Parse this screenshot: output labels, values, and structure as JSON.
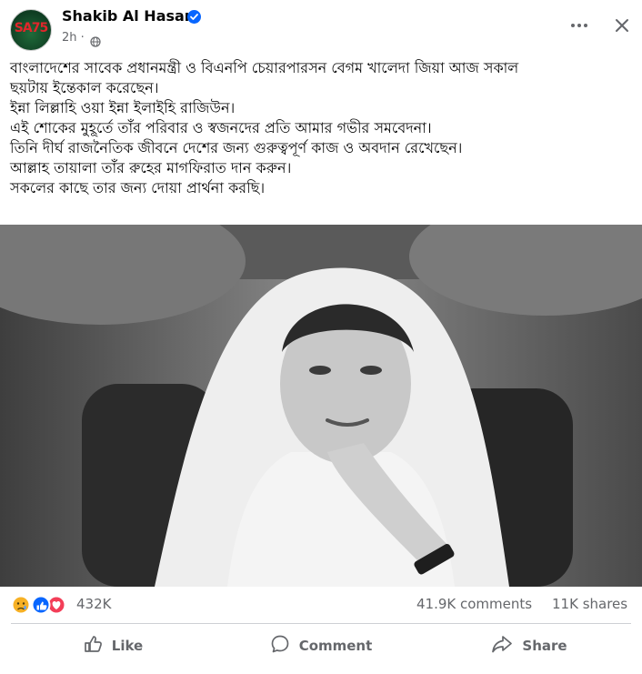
{
  "post": {
    "author": "Shakib Al Hasan",
    "avatar_text": "SA75",
    "time": "2h",
    "separator": "·",
    "message_lines": [
      "বাংলাদেশের সাবেক প্রধানমন্ত্রী ও বিএনপি চেয়ারপারসন বেগম খালেদা জিয়া আজ সকাল",
      "ছয়টায় ইন্তেকাল করেছেন।",
      "ইন্না লিল্লাহি ওয়া ইন্না ইলাইহি রাজিউন।",
      "এই শোকের মুহূর্তে তাঁর পরিবার ও স্বজনদের প্রতি আমার গভীর সমবেদনা।",
      "তিনি দীর্ঘ রাজনৈতিক জীবনে দেশের জন্য গুরুত্বপূর্ণ কাজ ও অবদান রেখেছেন।",
      "আল্লাহ তায়ালা তাঁর রুহের মাগফিরাত দান করুন।",
      "সকলের কাছে তার জন্য দোয়া প্রার্থনা করছি।"
    ]
  },
  "stats": {
    "reactions_count": "432K",
    "comments": "41.9K comments",
    "shares": "11K shares"
  },
  "actions": {
    "like": "Like",
    "comment": "Comment",
    "share": "Share"
  },
  "icons": {
    "verified": "verified-badge-icon",
    "globe": "globe-icon",
    "more": "more-options-icon",
    "close": "close-icon",
    "reaction_sad": "sad-reaction-icon",
    "reaction_like": "like-reaction-icon",
    "reaction_love": "love-reaction-icon"
  },
  "colors": {
    "text": "#050505",
    "secondary": "#65676b",
    "brand_blue": "#0866ff",
    "love_red": "#f33e58",
    "sad_yellow": "#f7b125"
  }
}
